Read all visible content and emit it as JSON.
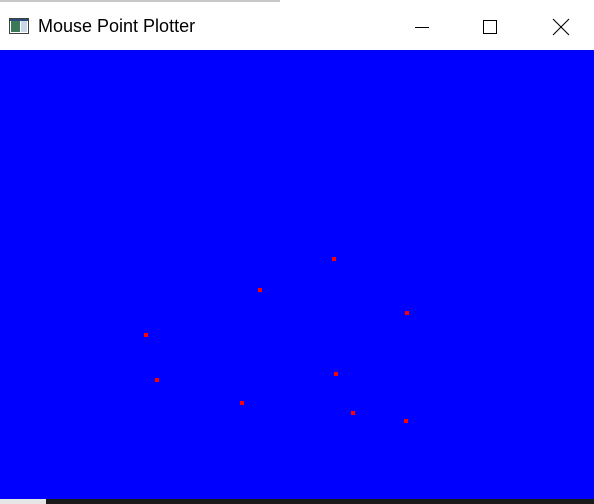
{
  "window": {
    "title": "Mouse Point Plotter",
    "icon": "app-window-icon",
    "controls": {
      "minimize_icon": "minimize-icon",
      "maximize_icon": "maximize-icon",
      "close_icon": "close-icon"
    }
  },
  "canvas": {
    "background_color": "#0000ff",
    "point_color": "#ff0000",
    "points": [
      {
        "id": "point-1"
      },
      {
        "id": "point-2"
      },
      {
        "id": "point-3"
      },
      {
        "id": "point-4"
      },
      {
        "id": "point-5"
      },
      {
        "id": "point-6"
      },
      {
        "id": "point-7"
      },
      {
        "id": "point-8"
      },
      {
        "id": "point-9"
      }
    ]
  }
}
